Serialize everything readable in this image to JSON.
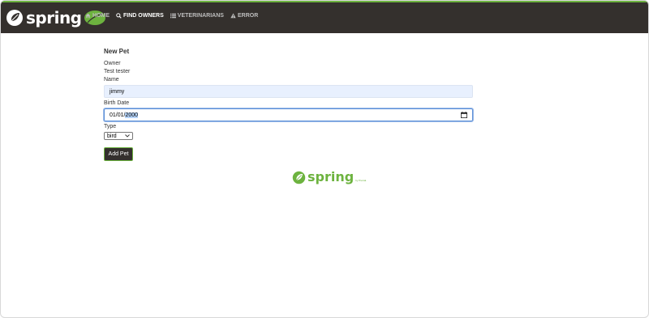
{
  "brand": {
    "name": "spring"
  },
  "nav": {
    "items": [
      {
        "label": "Home",
        "icon": "home-icon"
      },
      {
        "label": "Find owners",
        "icon": "search-icon"
      },
      {
        "label": "Veterinarians",
        "icon": "list-icon"
      },
      {
        "label": "Error",
        "icon": "warning-icon"
      }
    ],
    "active": "Find owners"
  },
  "form": {
    "heading": "New Pet",
    "owner_label": "Owner",
    "owner_value": "Test tester",
    "name_label": "Name",
    "name_value": "jimmy",
    "birth_label": "Birth Date",
    "birth_prefix": "01/01/",
    "birth_year": "2000",
    "type_label": "Type",
    "type_value": "bird",
    "submit_label": "Add Pet"
  },
  "footer": {
    "name": "spring",
    "by": "by Pivotal."
  },
  "colors": {
    "navbar": "#34302d",
    "accent": "#6db33f"
  }
}
